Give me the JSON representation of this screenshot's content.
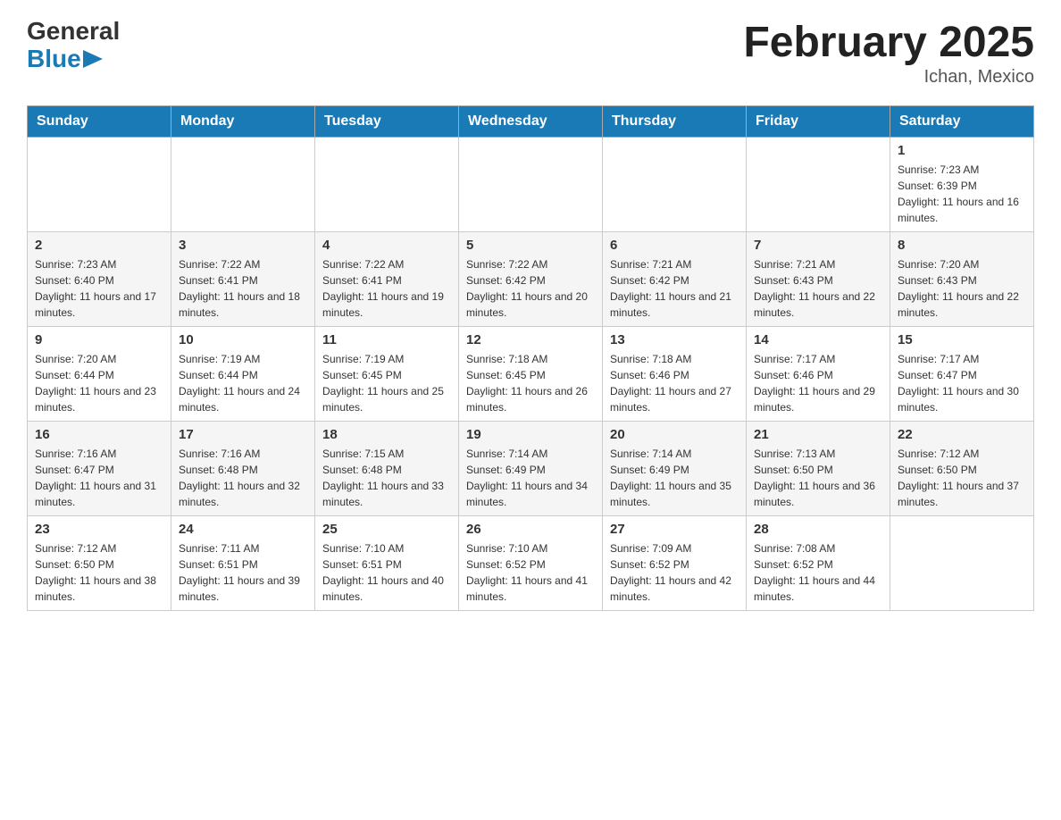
{
  "header": {
    "logo_text_general": "General",
    "logo_text_blue": "Blue",
    "title": "February 2025",
    "location": "Ichan, Mexico"
  },
  "weekdays": [
    "Sunday",
    "Monday",
    "Tuesday",
    "Wednesday",
    "Thursday",
    "Friday",
    "Saturday"
  ],
  "weeks": [
    [
      {
        "day": "",
        "info": ""
      },
      {
        "day": "",
        "info": ""
      },
      {
        "day": "",
        "info": ""
      },
      {
        "day": "",
        "info": ""
      },
      {
        "day": "",
        "info": ""
      },
      {
        "day": "",
        "info": ""
      },
      {
        "day": "1",
        "info": "Sunrise: 7:23 AM\nSunset: 6:39 PM\nDaylight: 11 hours and 16 minutes."
      }
    ],
    [
      {
        "day": "2",
        "info": "Sunrise: 7:23 AM\nSunset: 6:40 PM\nDaylight: 11 hours and 17 minutes."
      },
      {
        "day": "3",
        "info": "Sunrise: 7:22 AM\nSunset: 6:41 PM\nDaylight: 11 hours and 18 minutes."
      },
      {
        "day": "4",
        "info": "Sunrise: 7:22 AM\nSunset: 6:41 PM\nDaylight: 11 hours and 19 minutes."
      },
      {
        "day": "5",
        "info": "Sunrise: 7:22 AM\nSunset: 6:42 PM\nDaylight: 11 hours and 20 minutes."
      },
      {
        "day": "6",
        "info": "Sunrise: 7:21 AM\nSunset: 6:42 PM\nDaylight: 11 hours and 21 minutes."
      },
      {
        "day": "7",
        "info": "Sunrise: 7:21 AM\nSunset: 6:43 PM\nDaylight: 11 hours and 22 minutes."
      },
      {
        "day": "8",
        "info": "Sunrise: 7:20 AM\nSunset: 6:43 PM\nDaylight: 11 hours and 22 minutes."
      }
    ],
    [
      {
        "day": "9",
        "info": "Sunrise: 7:20 AM\nSunset: 6:44 PM\nDaylight: 11 hours and 23 minutes."
      },
      {
        "day": "10",
        "info": "Sunrise: 7:19 AM\nSunset: 6:44 PM\nDaylight: 11 hours and 24 minutes."
      },
      {
        "day": "11",
        "info": "Sunrise: 7:19 AM\nSunset: 6:45 PM\nDaylight: 11 hours and 25 minutes."
      },
      {
        "day": "12",
        "info": "Sunrise: 7:18 AM\nSunset: 6:45 PM\nDaylight: 11 hours and 26 minutes."
      },
      {
        "day": "13",
        "info": "Sunrise: 7:18 AM\nSunset: 6:46 PM\nDaylight: 11 hours and 27 minutes."
      },
      {
        "day": "14",
        "info": "Sunrise: 7:17 AM\nSunset: 6:46 PM\nDaylight: 11 hours and 29 minutes."
      },
      {
        "day": "15",
        "info": "Sunrise: 7:17 AM\nSunset: 6:47 PM\nDaylight: 11 hours and 30 minutes."
      }
    ],
    [
      {
        "day": "16",
        "info": "Sunrise: 7:16 AM\nSunset: 6:47 PM\nDaylight: 11 hours and 31 minutes."
      },
      {
        "day": "17",
        "info": "Sunrise: 7:16 AM\nSunset: 6:48 PM\nDaylight: 11 hours and 32 minutes."
      },
      {
        "day": "18",
        "info": "Sunrise: 7:15 AM\nSunset: 6:48 PM\nDaylight: 11 hours and 33 minutes."
      },
      {
        "day": "19",
        "info": "Sunrise: 7:14 AM\nSunset: 6:49 PM\nDaylight: 11 hours and 34 minutes."
      },
      {
        "day": "20",
        "info": "Sunrise: 7:14 AM\nSunset: 6:49 PM\nDaylight: 11 hours and 35 minutes."
      },
      {
        "day": "21",
        "info": "Sunrise: 7:13 AM\nSunset: 6:50 PM\nDaylight: 11 hours and 36 minutes."
      },
      {
        "day": "22",
        "info": "Sunrise: 7:12 AM\nSunset: 6:50 PM\nDaylight: 11 hours and 37 minutes."
      }
    ],
    [
      {
        "day": "23",
        "info": "Sunrise: 7:12 AM\nSunset: 6:50 PM\nDaylight: 11 hours and 38 minutes."
      },
      {
        "day": "24",
        "info": "Sunrise: 7:11 AM\nSunset: 6:51 PM\nDaylight: 11 hours and 39 minutes."
      },
      {
        "day": "25",
        "info": "Sunrise: 7:10 AM\nSunset: 6:51 PM\nDaylight: 11 hours and 40 minutes."
      },
      {
        "day": "26",
        "info": "Sunrise: 7:10 AM\nSunset: 6:52 PM\nDaylight: 11 hours and 41 minutes."
      },
      {
        "day": "27",
        "info": "Sunrise: 7:09 AM\nSunset: 6:52 PM\nDaylight: 11 hours and 42 minutes."
      },
      {
        "day": "28",
        "info": "Sunrise: 7:08 AM\nSunset: 6:52 PM\nDaylight: 11 hours and 44 minutes."
      },
      {
        "day": "",
        "info": ""
      }
    ]
  ]
}
